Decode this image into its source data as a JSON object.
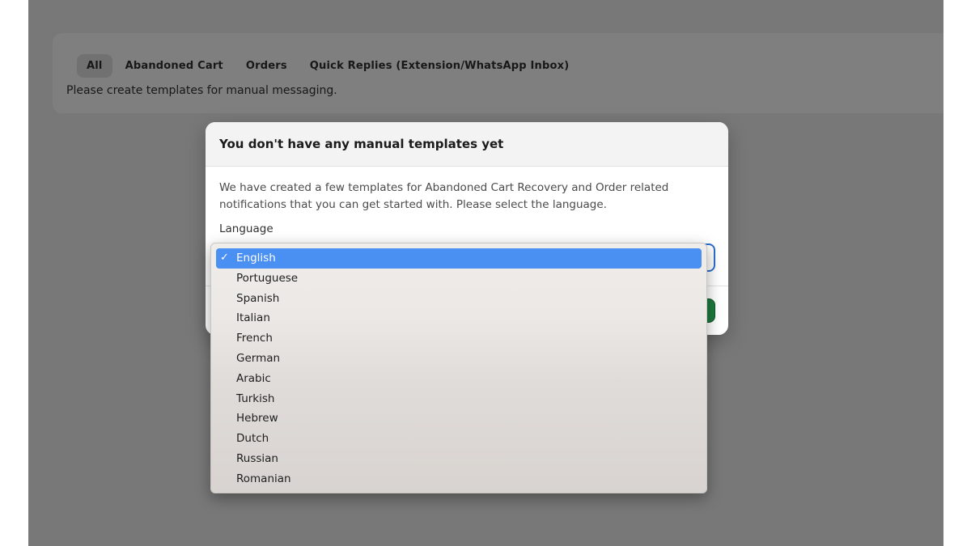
{
  "background_page": {
    "tabs": [
      {
        "label": "All",
        "active": true
      },
      {
        "label": "Abandoned Cart",
        "active": false
      },
      {
        "label": "Orders",
        "active": false
      },
      {
        "label": "Quick Replies (Extension/WhatsApp Inbox)",
        "active": false
      }
    ],
    "description": "Please create templates for manual messaging."
  },
  "modal": {
    "title": "You don't have any manual templates yet",
    "description": "We have created a few templates for Abandoned Cart Recovery and Order related notifications that you can get started with. Please select the language.",
    "language_label": "Language",
    "selected_language": "English"
  },
  "dropdown": {
    "options": [
      "English",
      "Portuguese",
      "Spanish",
      "Italian",
      "French",
      "German",
      "Arabic",
      "Turkish",
      "Hebrew",
      "Dutch",
      "Russian",
      "Romanian"
    ],
    "selected_index": 0,
    "check_icon": "checkmark-icon"
  },
  "colors": {
    "selection_highlight": "#4a8ff2",
    "focus_ring": "#2c6ecb",
    "primary_button": "#1d7a3f"
  }
}
